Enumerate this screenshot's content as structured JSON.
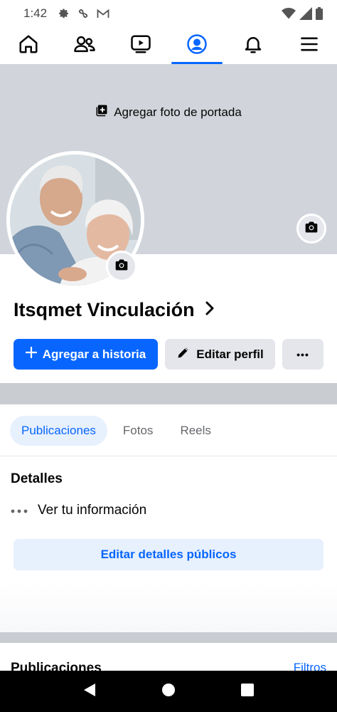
{
  "status_bar": {
    "time": "1:42",
    "left_icons": [
      "gear-icon",
      "pinwheel-icon",
      "gmail-icon"
    ],
    "right_icons": [
      "wifi-icon",
      "signal-icon",
      "battery-icon"
    ]
  },
  "top_nav": {
    "items": [
      {
        "icon": "home-icon",
        "active": false
      },
      {
        "icon": "friends-icon",
        "active": false
      },
      {
        "icon": "video-icon",
        "active": false
      },
      {
        "icon": "profile-icon",
        "active": true
      },
      {
        "icon": "bell-icon",
        "active": false
      },
      {
        "icon": "menu-icon",
        "active": false
      }
    ],
    "accent": "#0866ff"
  },
  "cover": {
    "add_label": "Agregar foto de portada",
    "background": "#d1d5db"
  },
  "profile": {
    "name": "Itsqmet Vinculación"
  },
  "actions": {
    "story_label": "Agregar a historia",
    "edit_label": "Editar perfil",
    "more_label": "•••"
  },
  "tabs": [
    {
      "label": "Publicaciones",
      "active": true
    },
    {
      "label": "Fotos",
      "active": false
    },
    {
      "label": "Reels",
      "active": false
    }
  ],
  "details": {
    "title": "Detalles",
    "info_label": "Ver tu información",
    "edit_public_label": "Editar detalles públicos"
  },
  "posts": {
    "title": "Publicaciones",
    "filters_label": "Filtros"
  },
  "colors": {
    "primary": "#0866ff",
    "secondary_bg": "#e4e6eb",
    "light_blue": "#e7f0fd",
    "divider": "#c9ccd1"
  }
}
